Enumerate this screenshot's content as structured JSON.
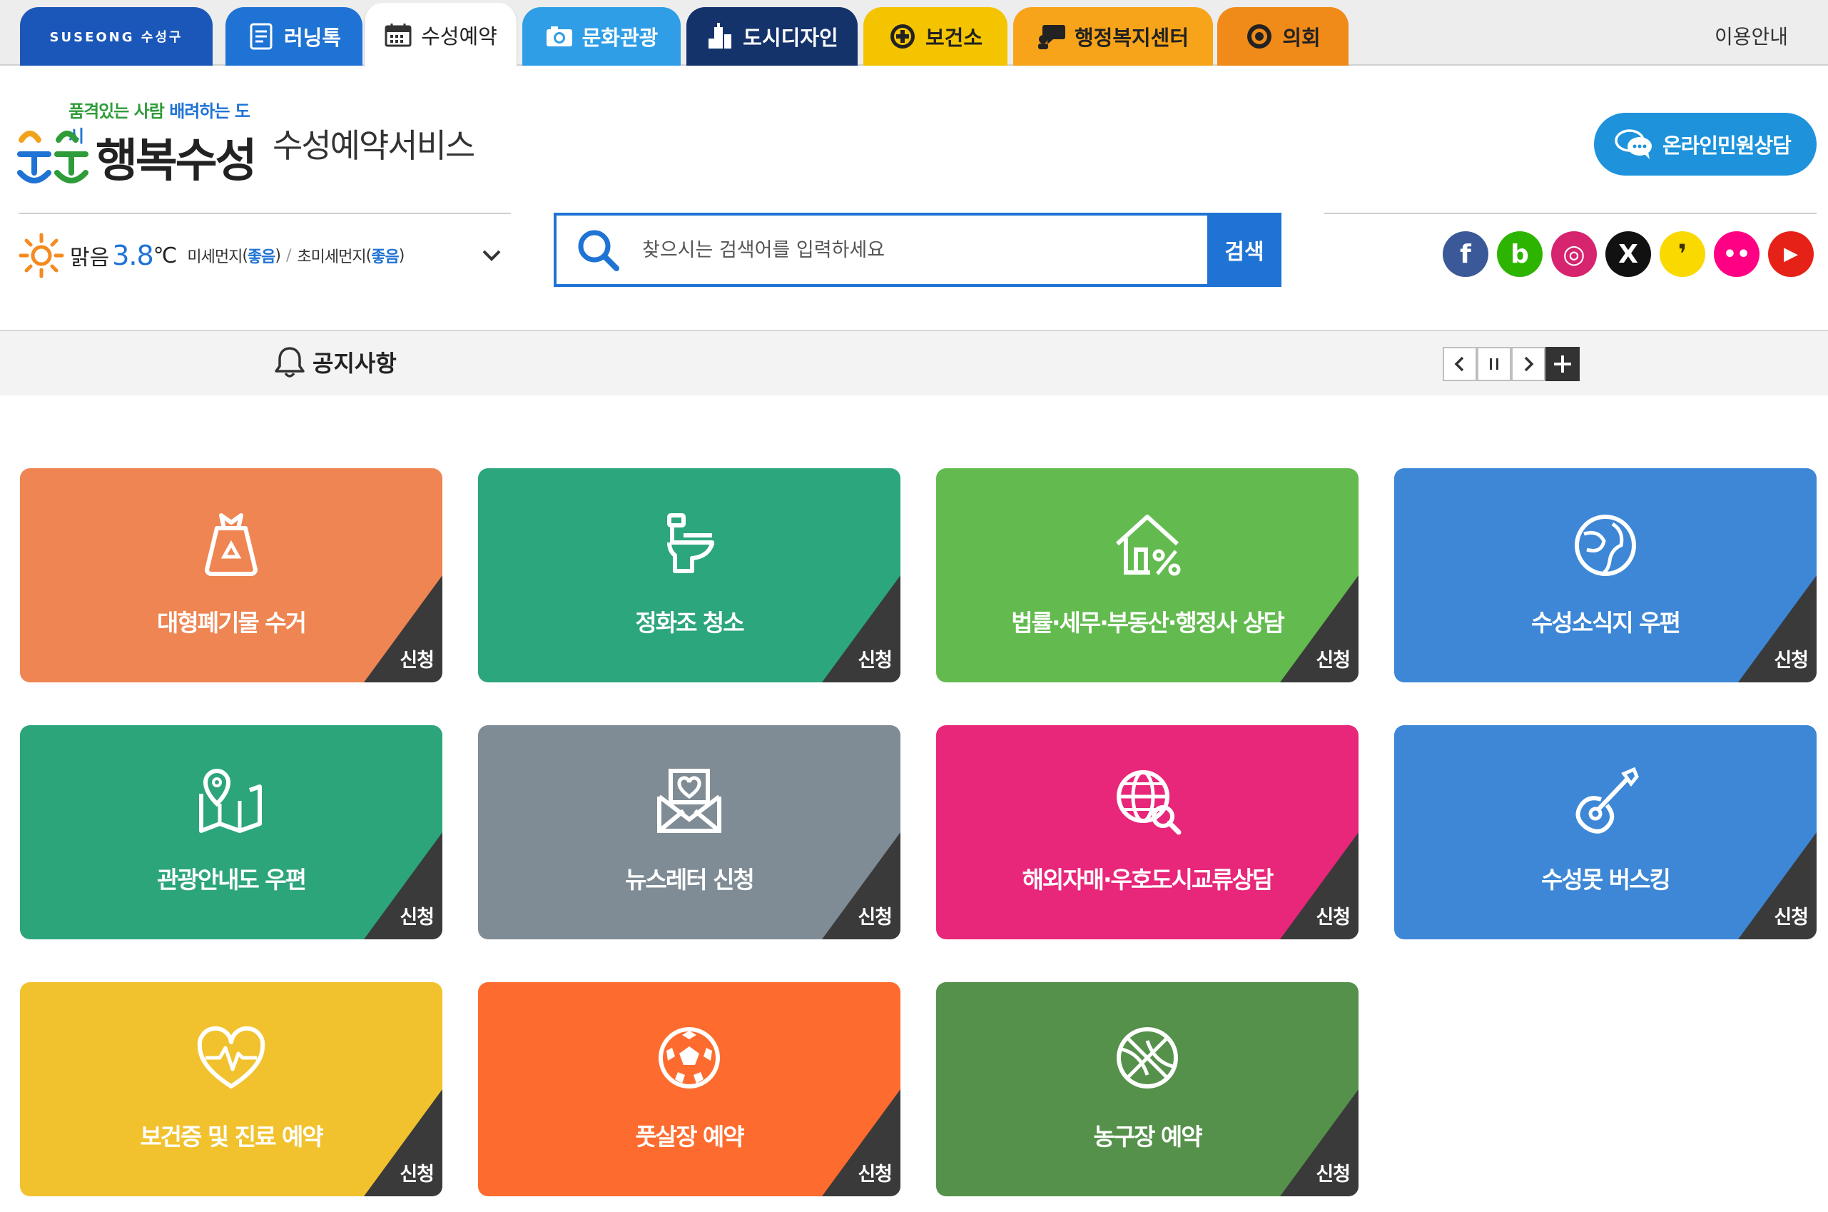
{
  "top_tabs": [
    {
      "label": "SUSEONG 수성구"
    },
    {
      "label": "러닝톡"
    },
    {
      "label": "수성예약"
    },
    {
      "label": "문화관광"
    },
    {
      "label": "도시디자인"
    },
    {
      "label": "보건소"
    },
    {
      "label": "행정복지센터"
    },
    {
      "label": "의회"
    }
  ],
  "usage_link": "이용안내",
  "logo": {
    "tagline_left": "품격있는 사람",
    "tagline_right": "배려하는 도시",
    "main": "행복수성"
  },
  "site_title": "수성예약서비스",
  "consult_button": "온라인민원상담",
  "weather": {
    "state": "맑음",
    "temp": "3.8",
    "unit": "℃",
    "dust_label": "미세먼지",
    "dust_value": "좋음",
    "fine_dust_label": "초미세먼지",
    "fine_dust_value": "좋음",
    "sep": "/",
    "paren_open": "(",
    "paren_close": ")"
  },
  "search": {
    "placeholder": "찾으시는 검색어를 입력하세요",
    "button": "검색"
  },
  "sns": [
    {
      "name": "facebook",
      "glyph": "f",
      "color": "#3b5998"
    },
    {
      "name": "blog",
      "glyph": "b",
      "color": "#2db400"
    },
    {
      "name": "instagram",
      "glyph": "◎",
      "color": "#d6246e"
    },
    {
      "name": "x",
      "glyph": "X",
      "color": "#111111"
    },
    {
      "name": "kakao-story",
      "glyph": "❜",
      "color": "#f9d900"
    },
    {
      "name": "flickr",
      "glyph": "••",
      "color": "#ff0084"
    },
    {
      "name": "youtube",
      "glyph": "▶",
      "color": "#e62117"
    }
  ],
  "notice": {
    "title": "공지사항"
  },
  "apply_label": "신청",
  "cards": [
    {
      "title": "대형폐기물 수거",
      "color": "#ee8552",
      "icon": "recycle-bag-icon"
    },
    {
      "title": "정화조 청소",
      "color": "#2ca67c",
      "icon": "toilet-icon"
    },
    {
      "title": "법률·세무·부동산·행정사 상담",
      "color": "#63bb4f",
      "icon": "house-percent-icon"
    },
    {
      "title": "수성소식지 우편",
      "color": "#3d87d6",
      "icon": "globe-leaf-icon"
    },
    {
      "title": "관광안내도 우편",
      "color": "#2ca57b",
      "icon": "map-pin-icon"
    },
    {
      "title": "뉴스레터 신청",
      "color": "#7f8c95",
      "icon": "envelope-heart-icon"
    },
    {
      "title": "해외자매·우호도시교류상담",
      "color": "#e8267a",
      "icon": "globe-search-icon"
    },
    {
      "title": "수성못 버스킹",
      "color": "#3d87d6",
      "icon": "guitar-icon"
    },
    {
      "title": "보건증 및 진료 예약",
      "color": "#f1c22e",
      "icon": "heart-pulse-icon"
    },
    {
      "title": "풋살장 예약",
      "color": "#fd6c2e",
      "icon": "soccer-ball-icon"
    },
    {
      "title": "농구장 예약",
      "color": "#55914b",
      "icon": "basketball-icon"
    }
  ]
}
